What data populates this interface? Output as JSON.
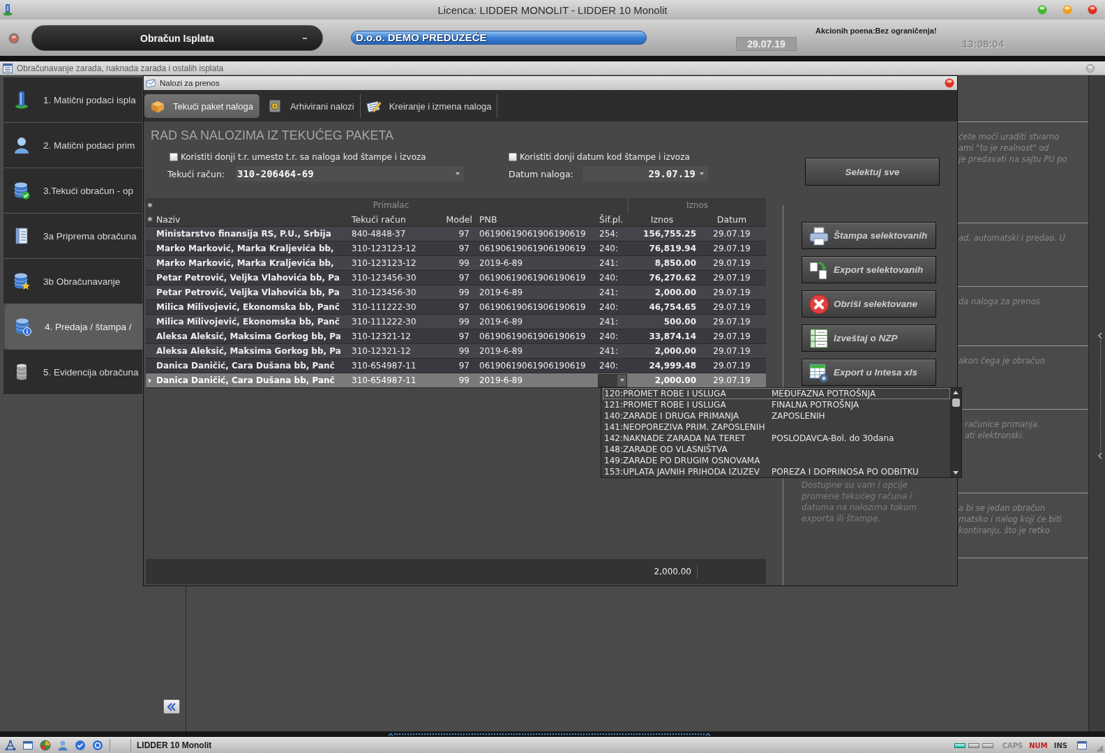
{
  "window": {
    "title": "Licenca: LIDDER MONOLIT - LIDDER 10 Monolit"
  },
  "header": {
    "module": "Obračun Isplata",
    "company": "D.o.o. DEMO PREDUZEĆE",
    "date": "29.07.19",
    "points": "Akcionih poena:Bez ograničenja!",
    "time": "13:08:04"
  },
  "subwindow": {
    "title": "Obračunavanje zarada, naknada zarada i ostalih isplata"
  },
  "sidebar": {
    "items": [
      {
        "label": "1. Matični podaci ispla",
        "selected": false
      },
      {
        "label": "2. Matični podaci prim",
        "selected": false
      },
      {
        "label": "3.Tekući obračun - op",
        "selected": false
      },
      {
        "label": "3a Priprema obračuna",
        "selected": false
      },
      {
        "label": "3b Obračunavanje",
        "selected": false
      },
      {
        "label": "4. Predaja / štampa /",
        "selected": true
      },
      {
        "label": "5. Evidencija obračuna",
        "selected": false
      }
    ]
  },
  "help_panel": {
    "sections": [
      {
        "lines": [
          "ćete moći uraditi stvarno",
          "ami \"to je realnost\" od",
          "je predavati na sajtu PU po"
        ]
      },
      {
        "lines": [
          "ad, automatski i predao. U"
        ]
      },
      {
        "lines": [
          "da naloga za prenos"
        ]
      },
      {
        "lines": [
          "akon čega je obračun"
        ]
      },
      {
        "lines": [
          "računice primanja.",
          "ati elektronski."
        ]
      },
      {
        "lines": [
          "a bi se jedan obračun",
          "matsko i nalog koji će biti",
          "kontiranju, što je retko"
        ]
      }
    ]
  },
  "dialog": {
    "title": "Nalozi za prenos",
    "tabs": [
      {
        "label": "Tekući paket naloga",
        "selected": true
      },
      {
        "label": "Arhivirani nalozi",
        "selected": false
      },
      {
        "label": "Kreiranje i izmena naloga",
        "selected": false
      }
    ],
    "heading": "RAD SA NALOZIMA IZ TEKUĆEG PAKETA",
    "options": [
      {
        "label": "Koristiti donji t.r. umesto t.r. sa naloga kod štampe i izvoza",
        "checked": false
      },
      {
        "label": "Koristiti donji datum kod štampe i izvoza",
        "checked": false
      }
    ],
    "fields": [
      {
        "label": "Tekući račun:",
        "value": "310-206464-69"
      },
      {
        "label": "Datum naloga:",
        "value": "29.07.19"
      }
    ],
    "select_all_button": "Selektuj sve",
    "actions": [
      "Štampa selektovanih",
      "Export selektovanih",
      "Obriši selektovane",
      "Izveštaj o NZP",
      "Export u Intesa xls"
    ],
    "note": "Dostupne su vam i opcije promene tekućeg računa i datuma na nalozima tokom exporta ili štampe.",
    "table": {
      "groups": [
        "Primalac",
        "Iznos"
      ],
      "columns": [
        "Naziv",
        "Tekući račun",
        "Model",
        "PNB",
        "Šif.pl.",
        "Iznos",
        "Datum"
      ],
      "rows": [
        {
          "naziv": "Ministarstvo finansija RS, P.U., Srbija",
          "racun": "840-4848-37",
          "model": "97",
          "pnb": "06190619061906190619",
          "sif_pl": "254:",
          "iznos": "156,755.25",
          "datum": "29.07.19",
          "selected": false,
          "editor_open": false
        },
        {
          "naziv": "Marko Marković, Marka Kraljevića bb,",
          "racun": "310-123123-12",
          "model": "97",
          "pnb": "06190619061906190619",
          "sif_pl": "240:",
          "iznos": "76,819.94",
          "datum": "29.07.19",
          "selected": false,
          "editor_open": false
        },
        {
          "naziv": "Marko Marković, Marka Kraljevića bb,",
          "racun": "310-123123-12",
          "model": "99",
          "pnb": "2019-6-89",
          "sif_pl": "241:",
          "iznos": "8,850.00",
          "datum": "29.07.19",
          "selected": false,
          "editor_open": false
        },
        {
          "naziv": "Petar Petrović, Veljka Vlahovića bb, Pa",
          "racun": "310-123456-30",
          "model": "97",
          "pnb": "06190619061906190619",
          "sif_pl": "240:",
          "iznos": "76,270.62",
          "datum": "29.07.19",
          "selected": false,
          "editor_open": false
        },
        {
          "naziv": "Petar Petrović, Veljka Vlahovića bb, Pa",
          "racun": "310-123456-30",
          "model": "99",
          "pnb": "2019-6-89",
          "sif_pl": "241:",
          "iznos": "2,000.00",
          "datum": "29.07.19",
          "selected": false,
          "editor_open": false
        },
        {
          "naziv": "Milica Milivojević, Ekonomska bb, Panč",
          "racun": "310-111222-30",
          "model": "97",
          "pnb": "06190619061906190619",
          "sif_pl": "240:",
          "iznos": "46,754.65",
          "datum": "29.07.19",
          "selected": false,
          "editor_open": false
        },
        {
          "naziv": "Milica Milivojević, Ekonomska bb, Panč",
          "racun": "310-111222-30",
          "model": "99",
          "pnb": "2019-6-89",
          "sif_pl": "241:",
          "iznos": "500.00",
          "datum": "29.07.19",
          "selected": false,
          "editor_open": false
        },
        {
          "naziv": "Aleksa Aleksić, Maksima Gorkog bb, Pa",
          "racun": "310-12321-12",
          "model": "97",
          "pnb": "06190619061906190619",
          "sif_pl": "240:",
          "iznos": "33,874.14",
          "datum": "29.07.19",
          "selected": false,
          "editor_open": false
        },
        {
          "naziv": "Aleksa Aleksić, Maksima Gorkog bb, Pa",
          "racun": "310-12321-12",
          "model": "99",
          "pnb": "2019-6-89",
          "sif_pl": "241:",
          "iznos": "2,000.00",
          "datum": "29.07.19",
          "selected": false,
          "editor_open": false
        },
        {
          "naziv": "Danica Daničić, Cara Dušana bb, Panč",
          "racun": "310-654987-11",
          "model": "97",
          "pnb": "06190619061906190619",
          "sif_pl": "240:",
          "iznos": "24,999.48",
          "datum": "29.07.19",
          "selected": false,
          "editor_open": false
        },
        {
          "naziv": "Danica Daničić, Cara Dušana bb, Panč",
          "racun": "310-654987-11",
          "model": "99",
          "pnb": "2019-6-89",
          "iznos": "2,000.00",
          "datum": "29.07.19",
          "selected": true,
          "editor_open": true
        }
      ],
      "footer_total": "2,000.00"
    },
    "code_dropdown": {
      "options": [
        {
          "code": "120:PROMET ROBE I USLUGA",
          "description": "MEĐUFAZNA POTROŠNJA",
          "selected": true
        },
        {
          "code": "121:PROMET ROBE I USLUGA",
          "description": "FINALNA POTROŠNJA",
          "selected": false
        },
        {
          "code": "140:ZARADE I DRUGA PRIMANJA",
          "description": "ZAPOSLENIH",
          "selected": false
        },
        {
          "code": "141:NEOPOREZIVA PRIM. ZAPOSLENIH",
          "selected": false
        },
        {
          "code": "142:NAKNADE ZARADA NA TERET",
          "description": "POSLODAVCA-Bol. do 30dana",
          "selected": false
        },
        {
          "code": "148:ZARADE OD VLASNIŠTVA",
          "selected": false
        },
        {
          "code": "149:ZARADE PO DRUGIM OSNOVAMA",
          "selected": false
        },
        {
          "code": "153:UPLATA JAVNIH PRIHODA IZUZEV",
          "description": "POREZA I DOPRINOSA PO ODBITKU",
          "selected": false
        }
      ]
    }
  },
  "status_bar": {
    "app": "LIDDER 10 Monolit",
    "lamps": [
      {
        "on": true
      },
      {
        "on": false
      },
      {
        "on": false
      }
    ],
    "keys": [
      {
        "label": "CAPS",
        "color": "#8c8c8c"
      },
      {
        "label": "NUM",
        "color": "#c02020"
      },
      {
        "label": "INS",
        "color": "#303030"
      }
    ]
  }
}
